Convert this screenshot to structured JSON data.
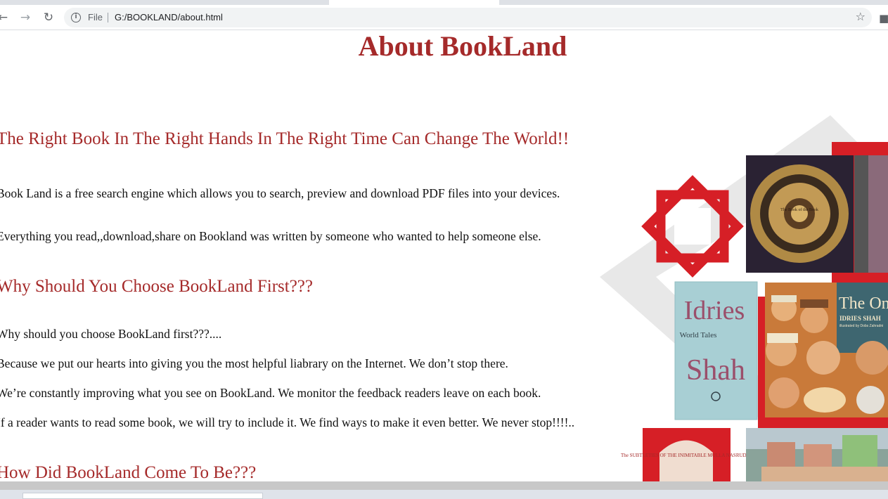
{
  "browser": {
    "scheme_label": "File",
    "url": "G:/BOOKLAND/about.html",
    "icons": {
      "back": "back-arrow-icon",
      "forward": "forward-arrow-icon",
      "reload": "reload-icon",
      "info": "info-icon",
      "bookmark": "star-icon",
      "extension": "puzzle-icon"
    }
  },
  "page": {
    "title": "About BookLand",
    "heading_1": "The Right Book In The Right Hands In The Right Time Can Change The World!!",
    "para_1": "Book Land is a free search engine which allows you to search, preview and download PDF files into your devices.",
    "para_2": "Everything you read,,download,share on Bookland was written by someone who wanted to help someone else.",
    "heading_2": "Why Should You Choose BookLand First???",
    "para_3": "Why should you choose BookLand first???....",
    "para_4": "Because we put our hearts into giving you the most helpful liabrary on the Internet. We don’t stop there.",
    "para_5": "We’re constantly improving what you see on BookLand. We monitor the feedback readers leave on each book.",
    "para_6": "If a reader wants to read some book, we will try to include it. We find ways to make it even better. We never stop!!!!..",
    "heading_3": "How Did BookLand Come To Be???",
    "collage": {
      "book_1_text": "The Book of the Book",
      "book_2_title_a": "Idries",
      "book_2_subtitle": "World Tales",
      "book_2_title_b": "Shah",
      "book_3_title": "The Oni",
      "book_3_author": "IDRIES SHAH",
      "book_3_sub": "illustrated by Dobs Zahradni",
      "book_4_text": "The SUBTLETIES OF THE INIMITABLE MULLA NASRUDIN"
    }
  },
  "colors": {
    "accent": "#a52a2a",
    "brand_red": "#d61f26"
  }
}
